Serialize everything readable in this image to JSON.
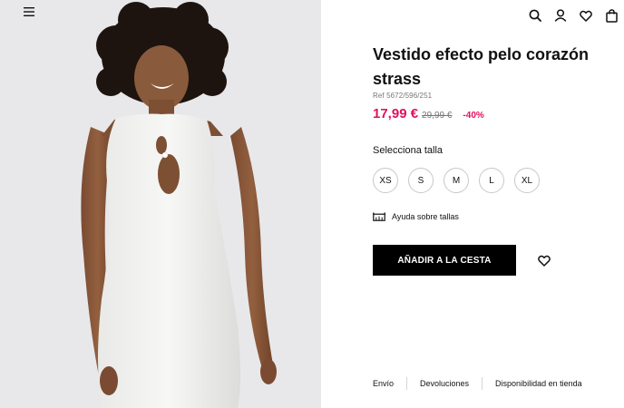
{
  "header": {
    "menu_icon": "hamburger-menu-icon",
    "icons": [
      "search-icon",
      "user-icon",
      "heart-icon",
      "bag-icon"
    ]
  },
  "product": {
    "title": "Vestido efecto pelo corazón strass",
    "ref": "Ref 5672/596/251",
    "price_current": "17,99 €",
    "price_old": "29,99 €",
    "discount": "-40%",
    "size_label": "Selecciona talla",
    "sizes": [
      "XS",
      "S",
      "M",
      "L",
      "XL"
    ],
    "size_help": "Ayuda sobre tallas",
    "add_to_cart": "AÑADIR A LA CESTA"
  },
  "footer": {
    "links": [
      "Envío",
      "Devoluciones",
      "Disponibilidad en tienda"
    ]
  },
  "colors": {
    "accent": "#e0115f",
    "button": "#000000",
    "image_bg": "#e8e8ea"
  }
}
